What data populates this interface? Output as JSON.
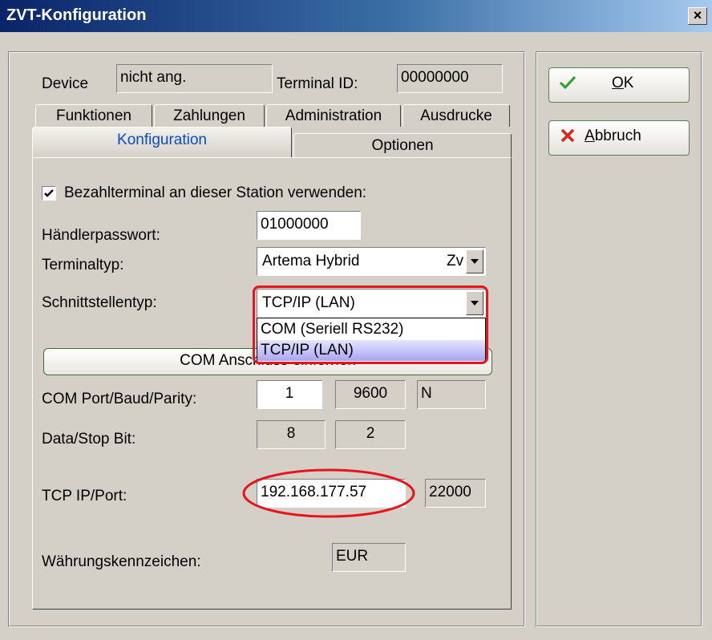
{
  "window": {
    "title": "ZVT-Konfiguration",
    "close_glyph": "×"
  },
  "header": {
    "device_label": "Device",
    "device_value": "nicht ang.",
    "terminal_id_label": "Terminal ID:",
    "terminal_id_value": "00000000"
  },
  "tabs_row1": [
    "Funktionen",
    "Zahlungen",
    "Administration",
    "Ausdrucke"
  ],
  "tabs_row2": [
    "Konfiguration",
    "Optionen"
  ],
  "config": {
    "use_terminal_label": "Bezahlterminal an dieser Station verwenden:",
    "use_terminal_checked": true,
    "merchant_password_label": "Händlerpasswort:",
    "merchant_password_value": "01000000",
    "terminal_type_label": "Terminaltyp:",
    "terminal_type_value": "Artema Hybrid",
    "terminal_type_suffix": "Zv",
    "interface_type_label": "Schnittstellentyp:",
    "interface_type_value": "TCP/IP (LAN)",
    "interface_options": [
      "COM (Seriell RS232)",
      "TCP/IP (LAN)"
    ],
    "interface_selected_index": 1,
    "com_button_label": "COM Anschluss einfernen",
    "com_port_label": "COM Port/Baud/Parity:",
    "com_port": "1",
    "baud": "9600",
    "parity": "N",
    "data_stop_label": "Data/Stop Bit:",
    "data_bit": "8",
    "stop_bit": "2",
    "tcp_label": "TCP IP/Port:",
    "tcp_ip": "192.168.177.57",
    "tcp_port": "22000",
    "currency_label": "Währungskennzeichen:",
    "currency_value": "EUR"
  },
  "buttons": {
    "ok_label": "OK",
    "ok_mnemonic": "O",
    "cancel_label": "Abbruch",
    "cancel_mnemonic": "A"
  },
  "colors": {
    "highlight_red": "#e8141c",
    "check_green": "#2aa02a",
    "cancel_red": "#d8241c",
    "active_tab_text": "#0a4ac8"
  }
}
